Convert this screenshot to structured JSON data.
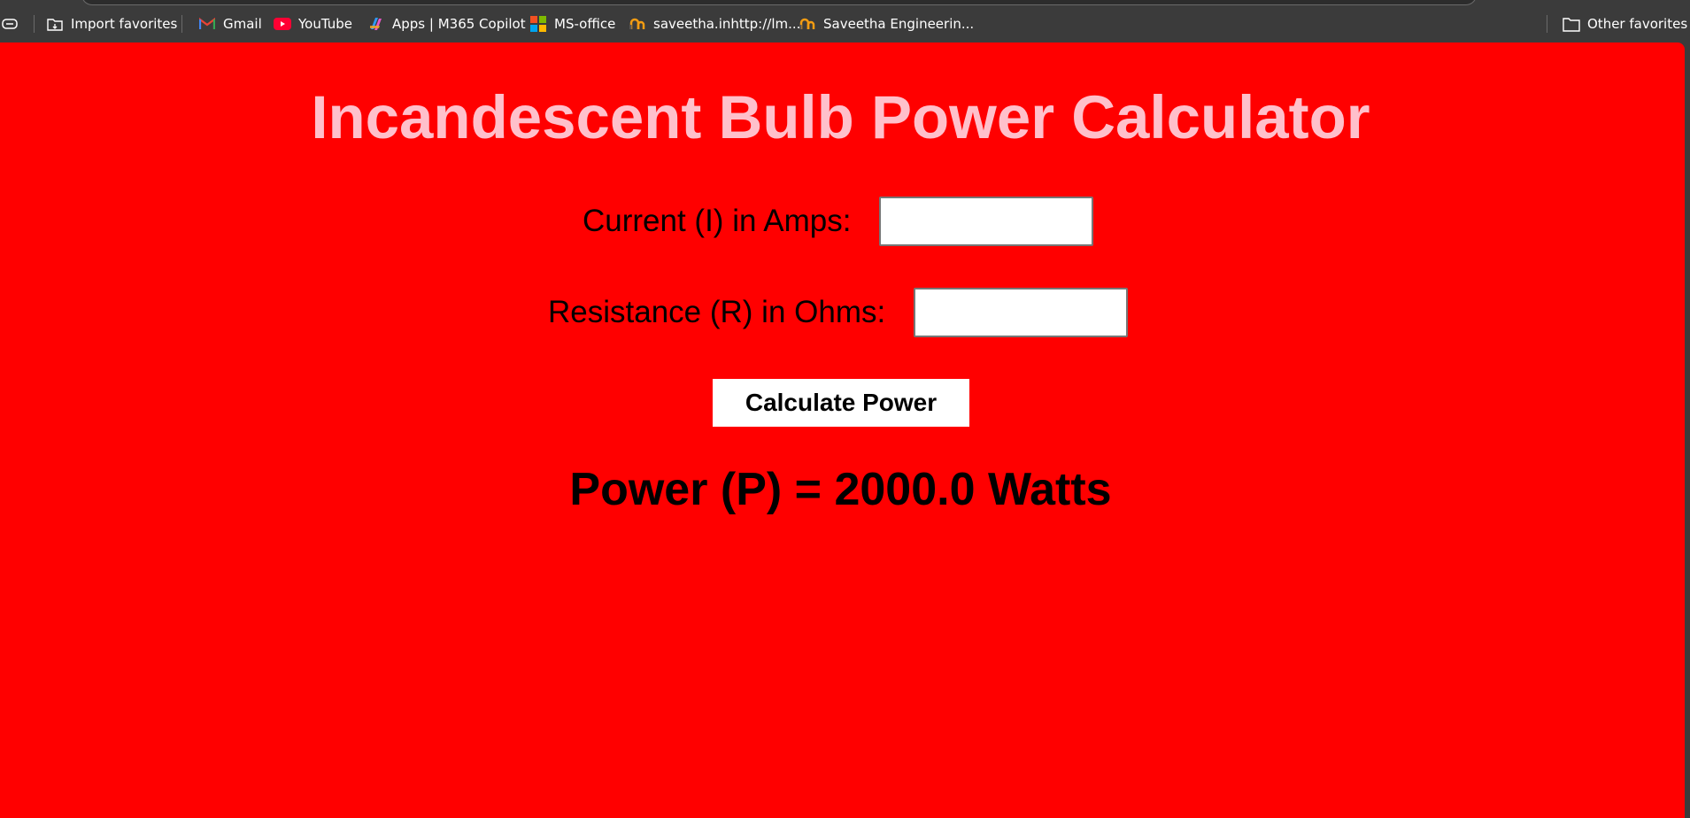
{
  "favorites_bar": {
    "import_favorites": "Import favorites",
    "items": [
      {
        "label": "Gmail",
        "icon": "gmail-icon"
      },
      {
        "label": "YouTube",
        "icon": "youtube-icon"
      },
      {
        "label": "Apps | M365 Copilot",
        "icon": "copilot-icon"
      },
      {
        "label": "MS-office",
        "icon": "microsoft-icon"
      },
      {
        "label": "saveetha.inhttp://lm...",
        "icon": "saveetha-icon"
      },
      {
        "label": "Saveetha Engineerin...",
        "icon": "saveetha-icon"
      }
    ],
    "other_favorites": "Other favorites"
  },
  "page": {
    "title": "Incandescent Bulb Power Calculator",
    "current_label": "Current (I) in Amps:",
    "current_value": "",
    "resistance_label": "Resistance (R) in Ohms:",
    "resistance_value": "",
    "button_label": "Calculate Power",
    "result": "Power (P) = 2000.0 Watts"
  },
  "colors": {
    "page_background": "#ff0000",
    "title": "#ffc0cb",
    "browser_chrome": "#3b3b3b"
  }
}
